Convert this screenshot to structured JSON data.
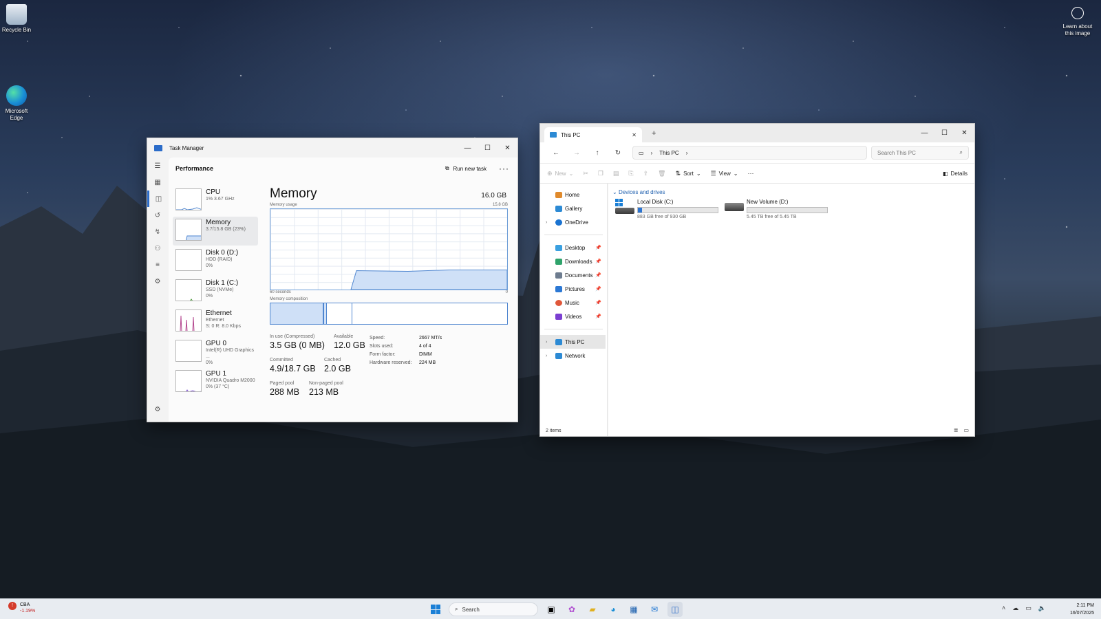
{
  "desktop": {
    "icons": [
      {
        "label": "Recycle Bin"
      },
      {
        "label": "Microsoft Edge"
      }
    ],
    "learn_about": "Learn about this image"
  },
  "task_manager": {
    "title": "Task Manager",
    "page": "Performance",
    "run_new_task": "Run new task",
    "resources": [
      {
        "name": "CPU",
        "sub1": "1%  3.67 GHz",
        "sub2": ""
      },
      {
        "name": "Memory",
        "sub1": "3.7/15.8 GB (23%)",
        "sub2": ""
      },
      {
        "name": "Disk 0 (D:)",
        "sub1": "HDD (RAID)",
        "sub2": "0%"
      },
      {
        "name": "Disk 1 (C:)",
        "sub1": "SSD (NVMe)",
        "sub2": "0%"
      },
      {
        "name": "Ethernet",
        "sub1": "Ethernet",
        "sub2": "S: 0  R: 8.0 Kbps"
      },
      {
        "name": "GPU 0",
        "sub1": "Intel(R) UHD Graphics ...",
        "sub2": "0%"
      },
      {
        "name": "GPU 1",
        "sub1": "NVIDIA Quadro M2000",
        "sub2": "0% (37 °C)"
      }
    ],
    "memory": {
      "heading": "Memory",
      "total": "16.0 GB",
      "usage_label": "Memory usage",
      "usage_max": "15.8 GB",
      "axis_left": "60 seconds",
      "axis_right": "0",
      "composition_label": "Memory composition",
      "in_use_label": "In use (Compressed)",
      "in_use": "3.5 GB (0 MB)",
      "available_label": "Available",
      "available": "12.0 GB",
      "committed_label": "Committed",
      "committed": "4.9/18.7 GB",
      "cached_label": "Cached",
      "cached": "2.0 GB",
      "paged_label": "Paged pool",
      "paged": "288 MB",
      "nonpaged_label": "Non-paged pool",
      "nonpaged": "213 MB",
      "specs": [
        {
          "k": "Speed:",
          "v": "2667 MT/s"
        },
        {
          "k": "Slots used:",
          "v": "4 of 4"
        },
        {
          "k": "Form factor:",
          "v": "DIMM"
        },
        {
          "k": "Hardware reserved:",
          "v": "224 MB"
        }
      ]
    }
  },
  "explorer": {
    "tab_title": "This PC",
    "breadcrumb": "This PC",
    "search_placeholder": "Search This PC",
    "commands": {
      "new": "New",
      "sort": "Sort",
      "view": "View",
      "details": "Details"
    },
    "nav": [
      {
        "label": "Home",
        "color": "#e08a2c",
        "pinned": false,
        "chevron": false
      },
      {
        "label": "Gallery",
        "color": "#2c8ad4",
        "pinned": false,
        "chevron": false
      },
      {
        "label": "OneDrive",
        "color": "#1a73d1",
        "pinned": false,
        "chevron": true
      }
    ],
    "quick_access": [
      {
        "label": "Desktop",
        "color": "#3aa0e0"
      },
      {
        "label": "Downloads",
        "color": "#2fa36b"
      },
      {
        "label": "Documents",
        "color": "#6d7c8f"
      },
      {
        "label": "Pictures",
        "color": "#2c78d4"
      },
      {
        "label": "Music",
        "color": "#e0573a"
      },
      {
        "label": "Videos",
        "color": "#7b3fd1"
      }
    ],
    "locations": [
      {
        "label": "This PC",
        "color": "#2c8ad4"
      },
      {
        "label": "Network",
        "color": "#2c8ad4"
      }
    ],
    "group": "Devices and drives",
    "drives": [
      {
        "name": "Local Disk (C:)",
        "free": "883 GB free of 930 GB",
        "used_fraction": 0.05
      },
      {
        "name": "New Volume (D:)",
        "free": "5.45 TB free of 5.45 TB",
        "used_fraction": 0.0
      }
    ],
    "status": "2 items"
  },
  "taskbar": {
    "stock_name": "CBA",
    "stock_change": "-1.19%",
    "search": "Search",
    "time": "2:11 PM",
    "date": "16/07/2025"
  },
  "colors": {
    "accent": "#2b6cc9",
    "graph_fill": "#cfe0f7",
    "graph_line": "#4f86d0"
  }
}
